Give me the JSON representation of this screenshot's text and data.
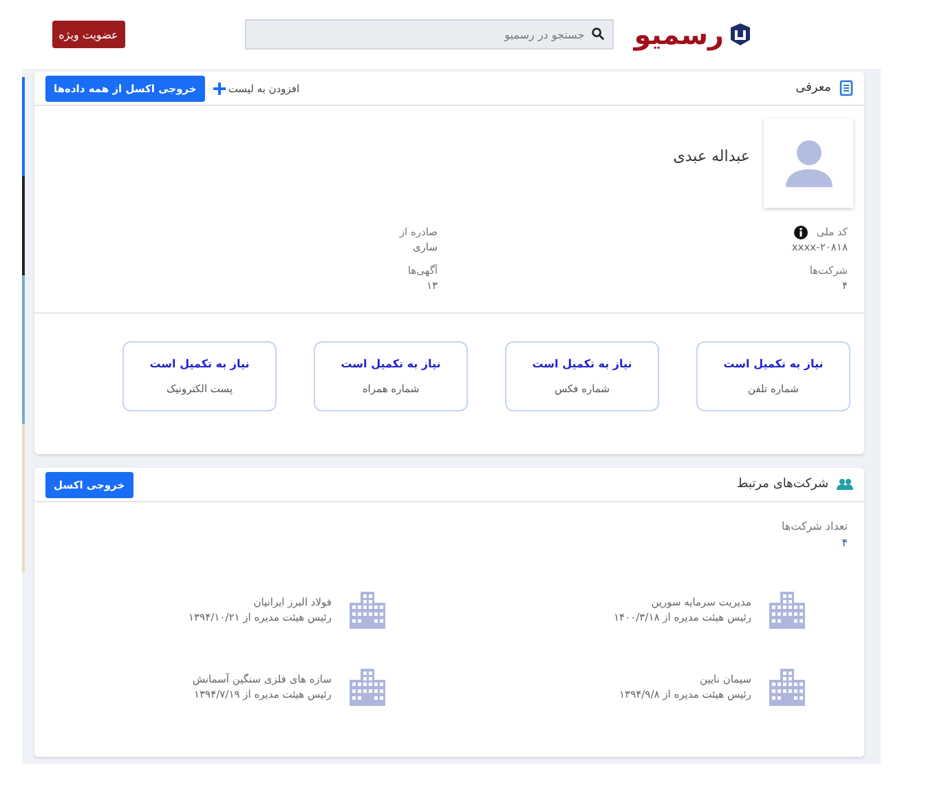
{
  "header": {
    "logo": "رسمیو",
    "search": {
      "placeholder": "جستجو در رسمیو"
    },
    "membership_button": "عضویت ویژه"
  },
  "intro": {
    "title": "معرفی",
    "add_to_list": "افزودن به لیست",
    "export_all": "خروجی اکسل از همه داده‌ها",
    "name": "عبداله عبدی",
    "fields": [
      {
        "label": "کد ملی",
        "value": "۲۰۸۱۸-xxxx",
        "info": true
      },
      {
        "label": "صادره از",
        "value": "ساری",
        "info": false
      },
      {
        "label": "شرکت‌ها",
        "value": "۴",
        "info": false
      },
      {
        "label": "آگهی‌ها",
        "value": "۱۳",
        "info": false
      }
    ],
    "missing": [
      {
        "status": "نیاز به تکمیل است",
        "label": "شماره تلفن"
      },
      {
        "status": "نیاز به تکمیل است",
        "label": "شماره فکس"
      },
      {
        "status": "نیاز به تکمیل است",
        "label": "شماره همراه"
      },
      {
        "status": "نیاز به تکمیل است",
        "label": "پست الکترونیک"
      }
    ]
  },
  "related": {
    "title": "شرکت‌های مرتبط",
    "export": "خروجی اکسل",
    "count_label": "تعداد شرکت‌ها",
    "count": "۴",
    "companies": [
      {
        "name": "مدیریت سرمایه سورین",
        "role": "رئیس هیئت مدیره از ۱۴۰۰/۳/۱۸"
      },
      {
        "name": "فولاد البرز ایرانیان",
        "role": "رئیس هیئت مدیره از ۱۳۹۴/۱۰/۲۱"
      },
      {
        "name": "سیمان نایین",
        "role": "رئیس هیئت مدیره از ۱۳۹۴/۹/۸"
      },
      {
        "name": "سازه های فلزی سنگین آسمانش",
        "role": "رئیس هیئت مدیره از ۱۳۹۴/۷/۱۹"
      }
    ]
  }
}
